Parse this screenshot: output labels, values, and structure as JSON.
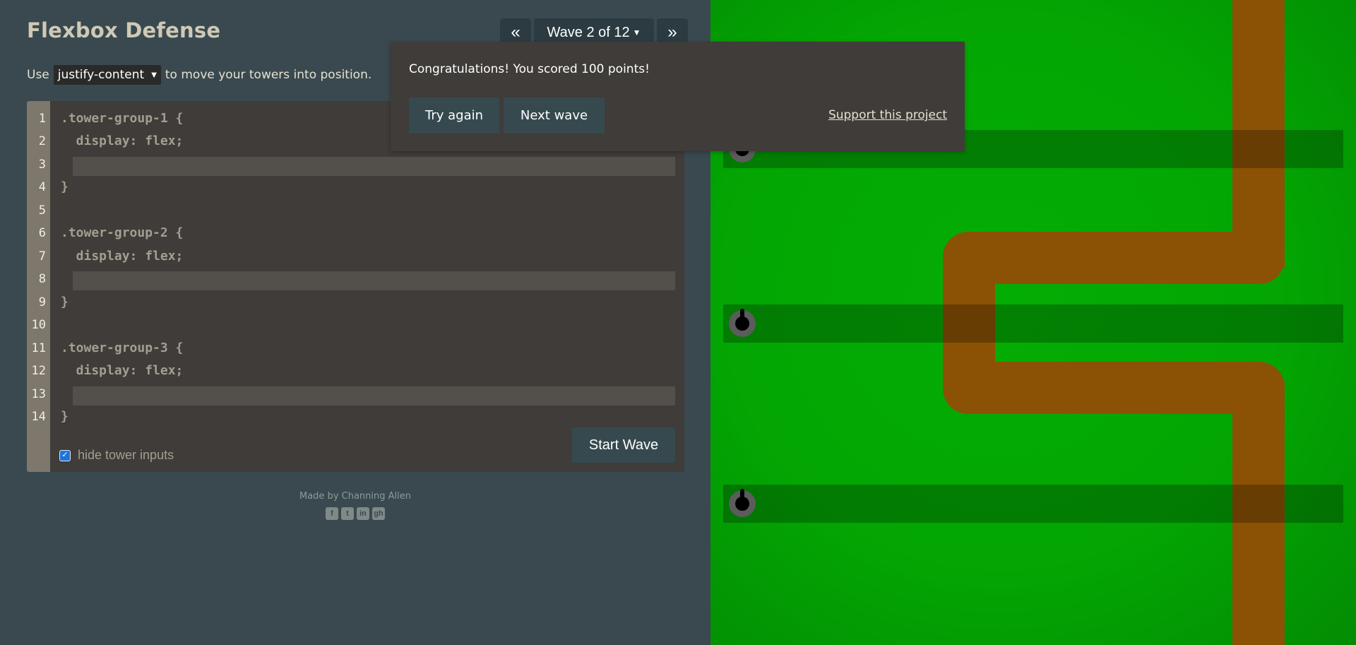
{
  "header": {
    "title": "Flexbox Defense",
    "wave_prev_label": "«",
    "wave_label": "Wave 2 of 12",
    "wave_next_label": "»"
  },
  "instructions": {
    "prefix": "Use",
    "property": "justify-content",
    "suffix": "to move your towers into position."
  },
  "editor": {
    "line_numbers": [
      "1",
      "2",
      "3",
      "4",
      "5",
      "6",
      "7",
      "8",
      "9",
      "10",
      "11",
      "12",
      "13",
      "14"
    ],
    "lines": [
      ".tower-group-1 {",
      "  display: flex;",
      "",
      "}",
      "",
      ".tower-group-2 {",
      "  display: flex;",
      "",
      "}",
      "",
      ".tower-group-3 {",
      "  display: flex;",
      "",
      "}"
    ],
    "inputs": [
      "",
      "",
      ""
    ],
    "hide_inputs_label": "hide tower inputs",
    "hide_inputs_checked": true,
    "start_button": "Start Wave"
  },
  "footer": {
    "credit": "Made by Channing Allen",
    "social_icons": [
      "facebook-icon",
      "twitter-icon",
      "linkedin-icon",
      "github-icon"
    ]
  },
  "popup": {
    "message": "Congratulations! You scored 100 points!",
    "try_again": "Try again",
    "next_wave": "Next wave",
    "support_link": "Support this project"
  },
  "board": {
    "colors": {
      "grass": "#03a603",
      "path": "#8b5205",
      "tower_row": "rgba(0,0,0,0.25)",
      "tower_base": "#5c5c5c"
    },
    "tower_rows": 3,
    "towers": 3
  }
}
